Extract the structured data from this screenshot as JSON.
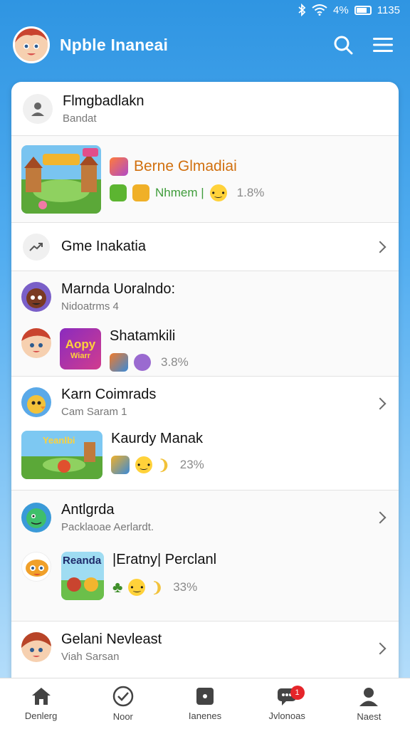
{
  "status": {
    "battery": "4%",
    "time": "1135"
  },
  "app": {
    "title": "Npble Inaneai"
  },
  "colors": {
    "accent": "#2f95e2",
    "badge": "#e5252a"
  },
  "profile": {
    "name": "Flmgbadlakn",
    "sub": "Bandat"
  },
  "featured": {
    "title": "Berne Glmadiai",
    "stat_text": "Nhmem |",
    "pct": "1.8%"
  },
  "section_link": {
    "label": "Gme Inakatia"
  },
  "rows": [
    {
      "name": "Marnda Uoralndo:",
      "sub": "Nidoatrms 4",
      "game": "Shatamkili",
      "thumb_text": "Aopy",
      "thumb_sub": "Wiarr",
      "pct": "3.8%"
    },
    {
      "name": "Karn Coimrads",
      "sub": "Cam Saram 1",
      "game": "Kaurdy Manak",
      "thumb_text": "Yeanlbi",
      "pct": "23%"
    },
    {
      "name": "Antlgrda",
      "sub": "Packlaoae Aerlardt.",
      "game": "|Eratny| Perclanl",
      "thumb_text": "Reanda",
      "pct": "33%"
    },
    {
      "name": "Gelani Nevleast",
      "sub": "Viah Sarsan"
    }
  ],
  "tabs": [
    {
      "label": "Denlerg",
      "icon": "home-icon"
    },
    {
      "label": "Noor",
      "icon": "check-circle-icon"
    },
    {
      "label": "Ianenes",
      "icon": "square-icon"
    },
    {
      "label": "Jvlonoas",
      "icon": "chat-icon",
      "badge": "1"
    },
    {
      "label": "Naest",
      "icon": "person-icon"
    }
  ]
}
